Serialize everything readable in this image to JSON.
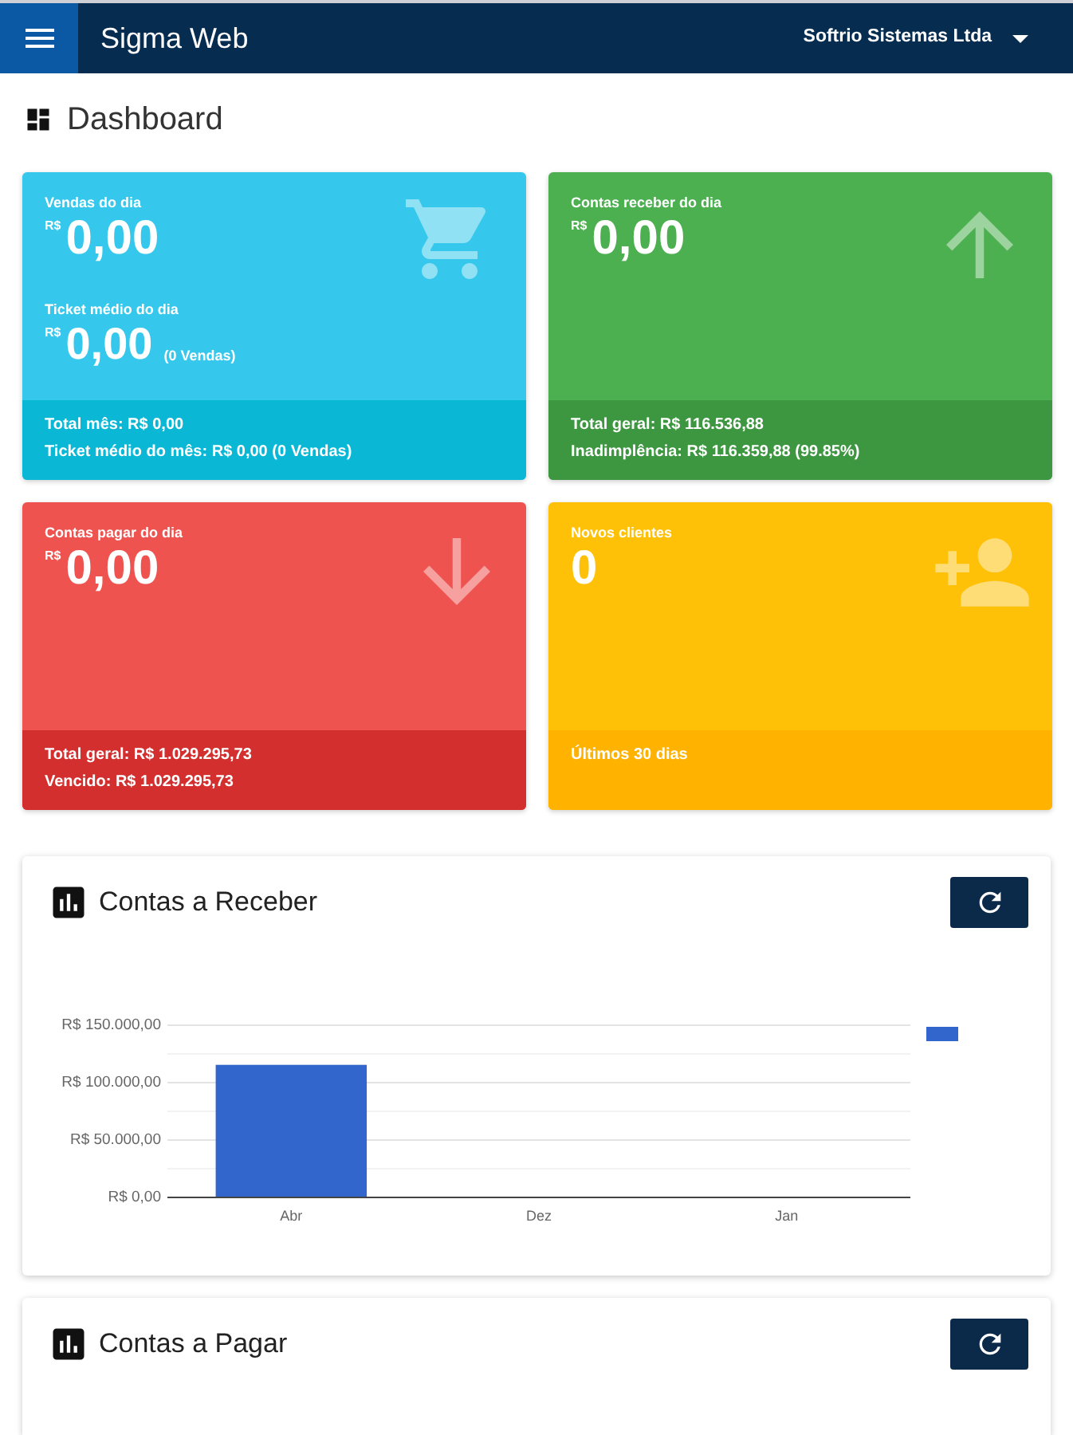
{
  "header": {
    "title": "Sigma Web",
    "company": "Softrio Sistemas Ltda"
  },
  "page": {
    "title": "Dashboard"
  },
  "cards": [
    {
      "kind": "sales",
      "color": "#35c8ec",
      "metrics": [
        {
          "label": "Vendas do dia",
          "currency": "R$",
          "value": "0,00"
        },
        {
          "label": "Ticket médio do dia",
          "currency": "R$",
          "value": "0,00",
          "note": "(0 Vendas)"
        }
      ],
      "footer": [
        "Total mês: R$ 0,00",
        "Ticket médio do mês: R$ 0,00 (0 Vendas)"
      ]
    },
    {
      "kind": "receivables",
      "color": "#4caf50",
      "metrics": [
        {
          "label": "Contas receber do dia",
          "currency": "R$",
          "value": "0,00"
        }
      ],
      "footer": [
        "Total geral: R$ 116.536,88",
        "Inadimplência: R$ 116.359,88 (99.85%)"
      ]
    },
    {
      "kind": "payables",
      "color": "#ef5350",
      "metrics": [
        {
          "label": "Contas pagar do dia",
          "currency": "R$",
          "value": "0,00"
        }
      ],
      "footer": [
        "Total geral: R$ 1.029.295,73",
        "Vencido: R$ 1.029.295,73"
      ]
    },
    {
      "kind": "clients",
      "color": "#ffc107",
      "metrics": [
        {
          "label": "Novos clientes",
          "value": "0"
        }
      ],
      "footer": [
        "Últimos 30 dias"
      ]
    }
  ],
  "panels": [
    {
      "title": "Contas a Receber",
      "chart": {
        "y_axis_labels": [
          "R$ 150.000,00",
          "R$ 100.000,00",
          "R$ 50.000,00",
          "R$ 0,00"
        ],
        "x_axis_labels": [
          "Abr",
          "Dez",
          "Jan"
        ]
      }
    },
    {
      "title": "Contas a Pagar"
    }
  ]
}
